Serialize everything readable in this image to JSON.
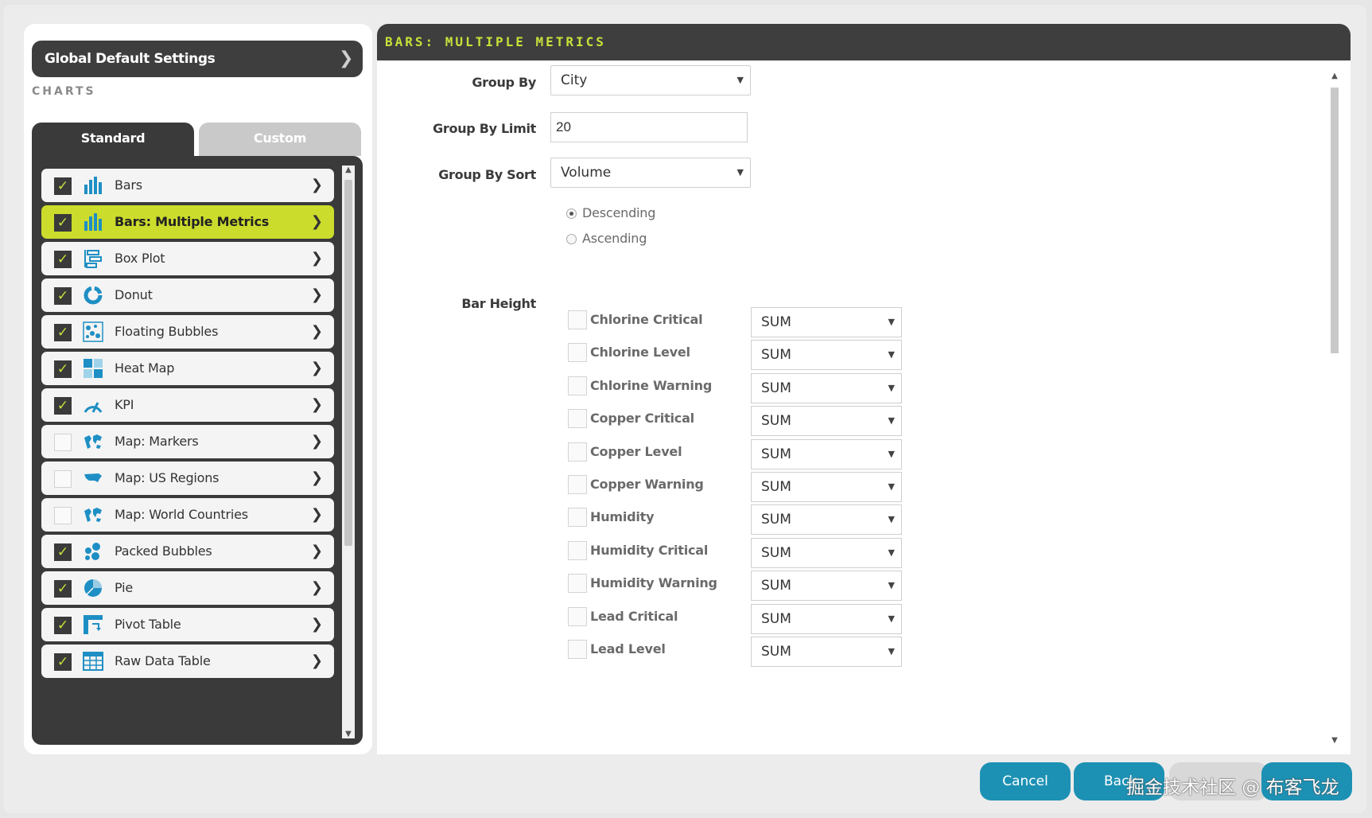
{
  "sidebar": {
    "global_default_settings": "Global Default Settings",
    "charts_label": "CHARTS",
    "tabs": {
      "standard": "Standard",
      "custom": "Custom"
    },
    "items": [
      {
        "label": "Bars",
        "checked": true,
        "icon": "bar-chart-icon"
      },
      {
        "label": "Bars: Multiple Metrics",
        "checked": true,
        "icon": "bar-chart-icon",
        "active": true
      },
      {
        "label": "Box Plot",
        "checked": true,
        "icon": "box-plot-icon"
      },
      {
        "label": "Donut",
        "checked": true,
        "icon": "donut-icon"
      },
      {
        "label": "Floating Bubbles",
        "checked": true,
        "icon": "floating-bubbles-icon"
      },
      {
        "label": "Heat Map",
        "checked": true,
        "icon": "heat-map-icon"
      },
      {
        "label": "KPI",
        "checked": true,
        "icon": "gauge-icon"
      },
      {
        "label": "Map: Markers",
        "checked": false,
        "icon": "world-map-icon"
      },
      {
        "label": "Map: US Regions",
        "checked": false,
        "icon": "us-map-icon"
      },
      {
        "label": "Map: World Countries",
        "checked": false,
        "icon": "world-map-icon"
      },
      {
        "label": "Packed Bubbles",
        "checked": true,
        "icon": "packed-bubbles-icon"
      },
      {
        "label": "Pie",
        "checked": true,
        "icon": "pie-icon"
      },
      {
        "label": "Pivot Table",
        "checked": true,
        "icon": "pivot-table-icon"
      },
      {
        "label": "Raw Data Table",
        "checked": true,
        "icon": "table-icon"
      }
    ],
    "check_mark": "✓",
    "chevron": "❯"
  },
  "panel": {
    "title": "BARS: MULTIPLE METRICS",
    "group_by": {
      "label": "Group By",
      "value": "City"
    },
    "group_by_limit": {
      "label": "Group By Limit",
      "value": "20"
    },
    "group_by_sort": {
      "label": "Group By Sort",
      "value": "Volume"
    },
    "sort_order": {
      "descending": "Descending",
      "ascending": "Ascending",
      "selected": "Descending"
    },
    "bar_height": {
      "label": "Bar Height",
      "metrics": [
        {
          "label": "Chlorine Critical",
          "agg": "SUM"
        },
        {
          "label": "Chlorine Level",
          "agg": "SUM"
        },
        {
          "label": "Chlorine Warning",
          "agg": "SUM"
        },
        {
          "label": "Copper Critical",
          "agg": "SUM"
        },
        {
          "label": "Copper Level",
          "agg": "SUM"
        },
        {
          "label": "Copper Warning",
          "agg": "SUM"
        },
        {
          "label": "Humidity",
          "agg": "SUM"
        },
        {
          "label": "Humidity Critical",
          "agg": "SUM"
        },
        {
          "label": "Humidity Warning",
          "agg": "SUM"
        },
        {
          "label": "Lead Critical",
          "agg": "SUM"
        },
        {
          "label": "Lead Level",
          "agg": "SUM"
        }
      ]
    }
  },
  "footer": {
    "cancel": "Cancel",
    "back": "Back",
    "watermark": "掘金技术社区 @ 布客飞龙"
  },
  "colors": {
    "accent_lime": "#cbdc2c",
    "dark": "#3a3a3a",
    "button_blue": "#1d91b4",
    "icon_blue": "#1e8fc4"
  }
}
